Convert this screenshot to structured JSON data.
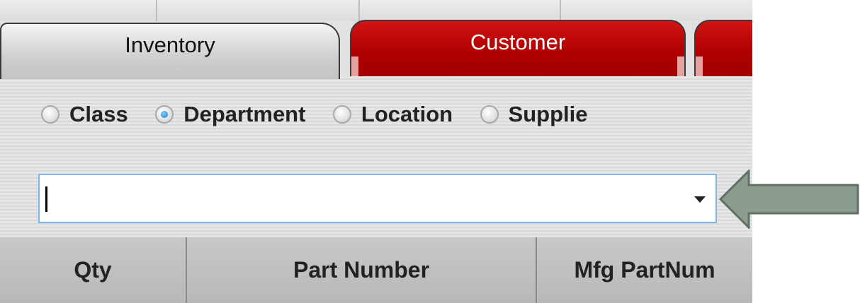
{
  "tabs": [
    {
      "label": "Inventory",
      "active": true
    },
    {
      "label": "Customer",
      "active": false
    },
    {
      "label": "",
      "active": false
    }
  ],
  "filter_options": [
    {
      "label": "Class",
      "selected": false
    },
    {
      "label": "Department",
      "selected": true
    },
    {
      "label": "Location",
      "selected": false
    },
    {
      "label": "Supplie",
      "selected": false
    }
  ],
  "filter_combo": {
    "value": "",
    "placeholder": ""
  },
  "grid": {
    "columns": [
      "Qty",
      "Part Number",
      "Mfg PartNum"
    ]
  },
  "colors": {
    "tab_active": "#cfcfcf",
    "tab_inactive": "#b00000",
    "radio_selected": "#1b78c8",
    "pointer_arrow": "#8c9c8f"
  }
}
